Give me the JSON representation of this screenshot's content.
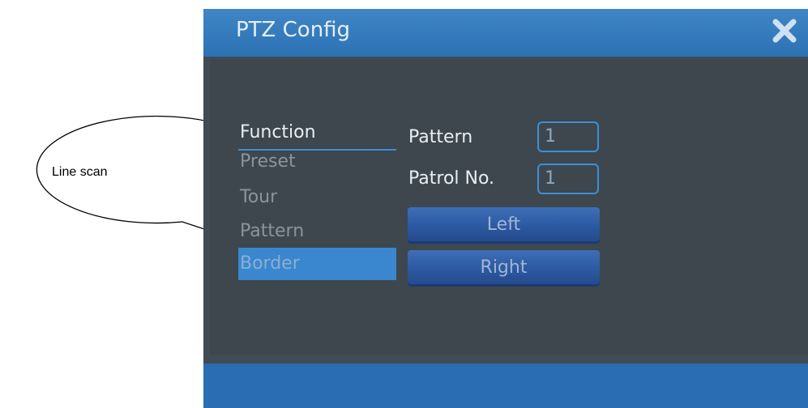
{
  "callout": {
    "text": "Line scan"
  },
  "window": {
    "title": "PTZ Config",
    "close_icon": "close-icon",
    "accent": "#2c72b4"
  },
  "menu": {
    "header": "Function",
    "items": [
      "Preset",
      "Tour",
      "Pattern",
      "Border"
    ],
    "selected": "Border"
  },
  "form": {
    "pattern_label": "Pattern",
    "pattern_value": "1",
    "patrol_label": "Patrol No.",
    "patrol_value": "1",
    "left_label": "Left",
    "right_label": "Right"
  }
}
